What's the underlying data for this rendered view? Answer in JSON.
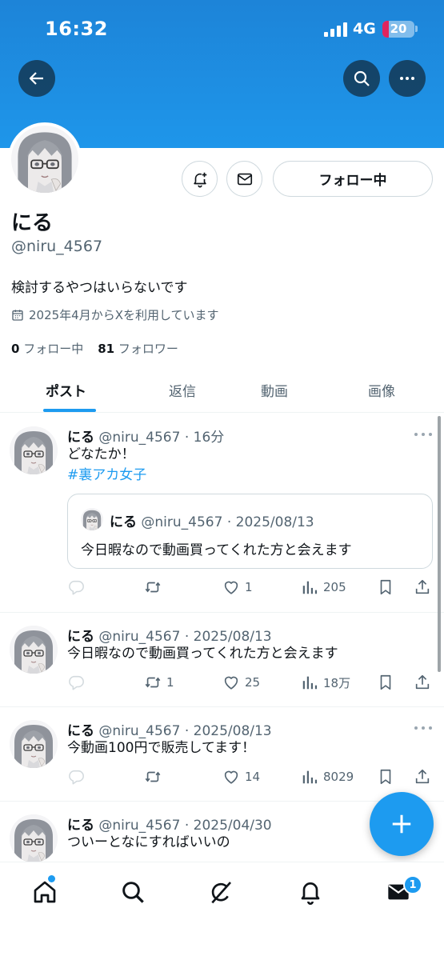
{
  "status_bar": {
    "time": "16:32",
    "network": "4G",
    "battery": "20",
    "battery_level": 0.2
  },
  "header": {
    "back_icon": "arrow-left-icon",
    "search_icon": "search-icon",
    "more_icon": "more-horizontal-icon",
    "banner_color": "#1d8fe1"
  },
  "profile": {
    "display_name": "にる",
    "handle": "@niru_4567",
    "bio": "検討するやつはいらないです",
    "joined": "2025年4月からXを利用しています",
    "following_count": "0",
    "following_label": "フォロー中",
    "followers_count": "81",
    "followers_label": "フォロワー",
    "follow_button": "フォロー中",
    "notify_icon": "bell-plus-icon",
    "message_icon": "mail-icon"
  },
  "tabs": [
    {
      "label": "ポスト",
      "active": true
    },
    {
      "label": "返信"
    },
    {
      "label": "動画"
    },
    {
      "label": "画像"
    }
  ],
  "posts": [
    {
      "name": "にる",
      "meta": "@niru_4567 · 16分",
      "lines": [
        "どなたか！"
      ],
      "hashtag": "#裏アカ女子",
      "quote": {
        "name": "にる",
        "meta": "@niru_4567 · 2025/08/13",
        "text": "今日暇なので動画買ってくれた方と会えます"
      },
      "reposts": "",
      "likes": "1",
      "views": "205"
    },
    {
      "name": "にる",
      "meta": "@niru_4567 · 2025/08/13",
      "lines": [
        "今日暇なので動画買ってくれた方と会えます"
      ],
      "reposts": "1",
      "likes": "25",
      "views": "18万"
    },
    {
      "name": "にる",
      "meta": "@niru_4567 · 2025/08/13",
      "lines": [
        "今動画100円で販売してます！"
      ],
      "reposts": "",
      "likes": "14",
      "views": "8029"
    },
    {
      "name": "にる",
      "meta": "@niru_4567 · 2025/04/30",
      "lines": [
        "ついーとなにすればいいの"
      ]
    }
  ],
  "fab": {
    "icon": "plus-icon"
  },
  "bottom_nav": {
    "items": [
      "home-icon",
      "search-icon",
      "grok-icon",
      "bell-icon",
      "mail-icon"
    ],
    "messages_badge": "1"
  },
  "colors": {
    "accent": "#1d9bf0",
    "text": "#0f1419",
    "muted": "#536471"
  }
}
